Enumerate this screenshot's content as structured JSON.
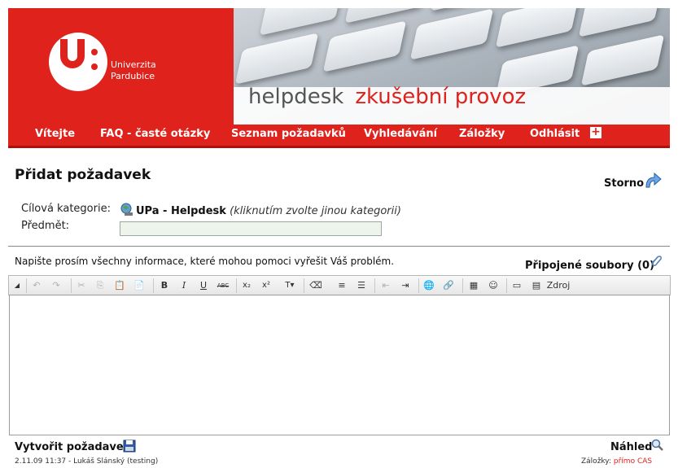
{
  "header": {
    "university_line1": "Univerzita",
    "university_line2": "Pardubice",
    "app_name": "helpdesk",
    "app_mode": "zkušební provoz",
    "accent_color": "#e0221d"
  },
  "nav": {
    "items": [
      {
        "label": "Vítejte"
      },
      {
        "label": "FAQ - časté otázky"
      },
      {
        "label": "Seznam požadavků"
      },
      {
        "label": "Vyhledávání"
      },
      {
        "label": "Záložky"
      },
      {
        "label": "Odhlásit"
      }
    ],
    "plus_icon": "+"
  },
  "form": {
    "title": "Přidat požadavek",
    "storno_label": "Storno",
    "category_label": "Cílová kategorie:",
    "category_value": "UPa - Helpdesk",
    "category_hint": "(kliknutím zvolte jinou kategorii)",
    "subject_label": "Předmět:",
    "subject_value": "",
    "info_text": "Napište prosím všechny informace, které mohou pomoci vyřešit Váš problém.",
    "attachments_label": "Připojené soubory (0)"
  },
  "editor": {
    "source_label": "Zdroj"
  },
  "footer": {
    "create_label": "Vytvořit požadavek",
    "preview_label": "Náhled",
    "meta": "2.11.09 11:37 - Lukáš Slánský (testing)",
    "bookmarks_label": "Záložky:",
    "bookmarks_link": "přímo CAS"
  }
}
